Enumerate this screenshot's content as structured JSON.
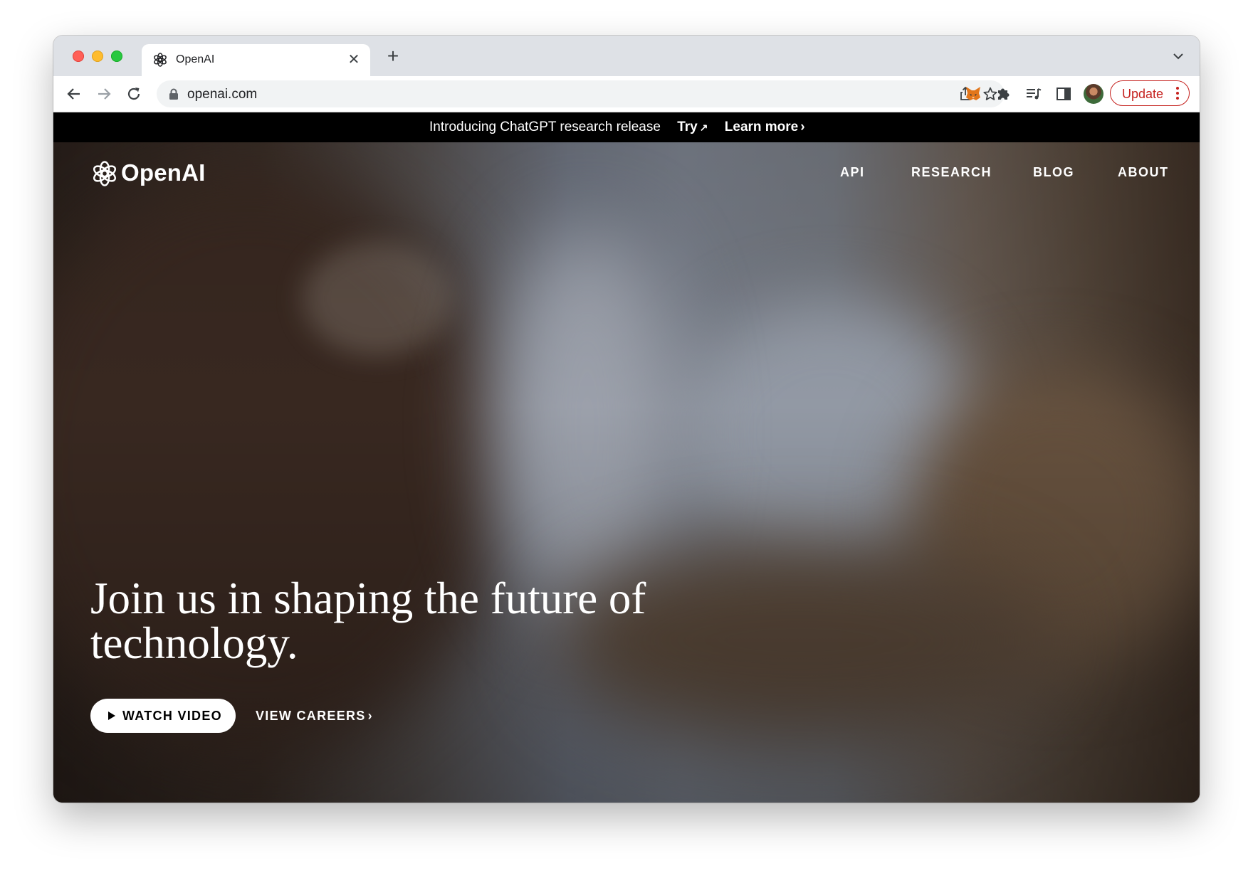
{
  "browser": {
    "tab_title": "OpenAI",
    "url": "openai.com",
    "update_label": "Update"
  },
  "announcement": {
    "text": "Introducing ChatGPT research release",
    "try_label": "Try",
    "try_arrow": "↗",
    "learn_more_label": "Learn more",
    "learn_more_arrow": "›"
  },
  "site": {
    "logo_text": "OpenAI",
    "nav": [
      "API",
      "RESEARCH",
      "BLOG",
      "ABOUT"
    ]
  },
  "hero": {
    "headline": "Join us in shaping the future of technology.",
    "watch_video_label": "WATCH VIDEO",
    "view_careers_label": "VIEW CAREERS",
    "view_careers_arrow": "›"
  },
  "colors": {
    "update_accent": "#c5221f",
    "announcement_bg": "#000000",
    "tab_strip_bg": "#dee1e6"
  },
  "icons": {
    "tab_strip": [
      "openai-favicon-icon",
      "close-icon",
      "plus-icon",
      "chevron-down-icon"
    ],
    "toolbar": [
      "back-arrow-icon",
      "forward-arrow-icon",
      "reload-icon",
      "lock-icon",
      "share-icon",
      "star-icon",
      "metamask-fox-icon",
      "puzzle-extensions-icon",
      "media-queue-icon",
      "side-panel-icon",
      "more-vertical-icon"
    ],
    "page": [
      "openai-logo-icon",
      "play-icon"
    ]
  }
}
